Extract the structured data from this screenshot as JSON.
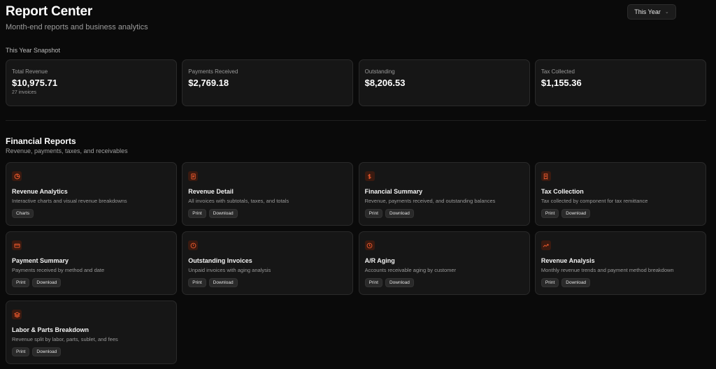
{
  "header": {
    "title": "Report Center",
    "subtitle": "Month-end reports and business analytics",
    "period": "This Year"
  },
  "snapshot": {
    "label": "This Year Snapshot",
    "cards": [
      {
        "label": "Total Revenue",
        "value": "$10,975.71",
        "sub": "27 invoices"
      },
      {
        "label": "Payments Received",
        "value": "$2,769.18",
        "sub": ""
      },
      {
        "label": "Outstanding",
        "value": "$8,206.53",
        "sub": ""
      },
      {
        "label": "Tax Collected",
        "value": "$1,155.36",
        "sub": ""
      }
    ]
  },
  "financial": {
    "title": "Financial Reports",
    "subtitle": "Revenue, payments, taxes, and receivables",
    "reports": [
      {
        "icon": "pie-chart-icon",
        "title": "Revenue Analytics",
        "desc": "Interactive charts and visual revenue breakdowns",
        "actions": [
          "Charts"
        ]
      },
      {
        "icon": "document-icon",
        "title": "Revenue Detail",
        "desc": "All invoices with subtotals, taxes, and totals",
        "actions": [
          "Print",
          "Download"
        ]
      },
      {
        "icon": "dollar-icon",
        "title": "Financial Summary",
        "desc": "Revenue, payments received, and outstanding balances",
        "actions": [
          "Print",
          "Download"
        ]
      },
      {
        "icon": "receipt-icon",
        "title": "Tax Collection",
        "desc": "Tax collected by component for tax remittance",
        "actions": [
          "Print",
          "Download"
        ]
      },
      {
        "icon": "credit-card-icon",
        "title": "Payment Summary",
        "desc": "Payments received by method and date",
        "actions": [
          "Print",
          "Download"
        ]
      },
      {
        "icon": "alert-circle-icon",
        "title": "Outstanding Invoices",
        "desc": "Unpaid invoices with aging analysis",
        "actions": [
          "Print",
          "Download"
        ]
      },
      {
        "icon": "clock-icon",
        "title": "A/R Aging",
        "desc": "Accounts receivable aging by customer",
        "actions": [
          "Print",
          "Download"
        ]
      },
      {
        "icon": "trend-up-icon",
        "title": "Revenue Analysis",
        "desc": "Monthly revenue trends and payment method breakdown",
        "actions": [
          "Print",
          "Download"
        ]
      },
      {
        "icon": "layers-icon",
        "title": "Labor & Parts Breakdown",
        "desc": "Revenue split by labor, parts, sublet, and fees",
        "actions": [
          "Print",
          "Download"
        ]
      }
    ]
  },
  "colors": {
    "accent": "#e0552b",
    "icon_bg": "#3a1a10",
    "card_bg": "#161616"
  }
}
